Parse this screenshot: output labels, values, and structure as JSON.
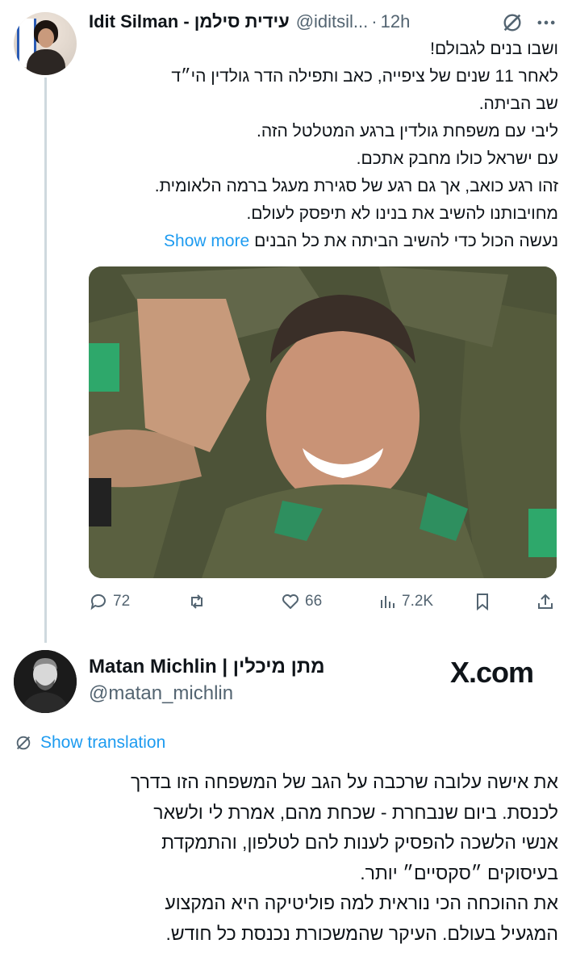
{
  "tweet1": {
    "name": "Idit Silman - עידית סילמן",
    "handle": "@iditsil...",
    "dot": "·",
    "time": "12h",
    "lines": [
      "ושבו בנים לגבולם!",
      "לאחר 11 שנים של ציפייה, כאב ותפילה הדר גולדין הי״ד",
      "שב הביתה.",
      "ליבי עם משפחת גולדין ברגע המטלטל הזה.",
      "עם ישראל כולו מחבק אתכם.",
      "זהו רגע כואב, אך גם רגע של סגירת מעגל ברמה הלאומית.",
      "מחויבותנו להשיב את בנינו לא תיפסק לעולם."
    ],
    "last_line": "נעשה הכול כדי להשיב הביתה את כל הבנים",
    "show_more": "Show more",
    "replies": "72",
    "likes": "66",
    "views": "7.2K"
  },
  "tweet2": {
    "name": "Matan Michlin | מתן מיכלין",
    "handle": "@matan_michlin",
    "brand": "X.com",
    "show_translation": "Show translation",
    "lines": [
      "את אישה עלובה שרכבה על הגב של המשפחה הזו בדרך",
      "לכנסת. ביום שנבחרת - שכחת מהם, אמרת לי ולשאר",
      "אנשי הלשכה להפסיק לענות להם לטלפון, והתמקדת",
      "בעיסוקים ״סקסיים״ יותר.",
      "את ההוכחה הכי נוראית למה פוליטיקה היא המקצוע",
      "המגעיל בעולם. העיקר שהמשכורת נכנסת כל חודש."
    ]
  },
  "icons": [
    "grok-icon",
    "more-icon",
    "reply-icon",
    "retweet-icon",
    "like-icon",
    "views-icon",
    "bookmark-icon",
    "share-icon",
    "translate-icon"
  ],
  "colors": {
    "accent": "#1d9bf0",
    "secondary_text": "#536471",
    "text": "#0f1419",
    "line": "#cfd9de"
  }
}
